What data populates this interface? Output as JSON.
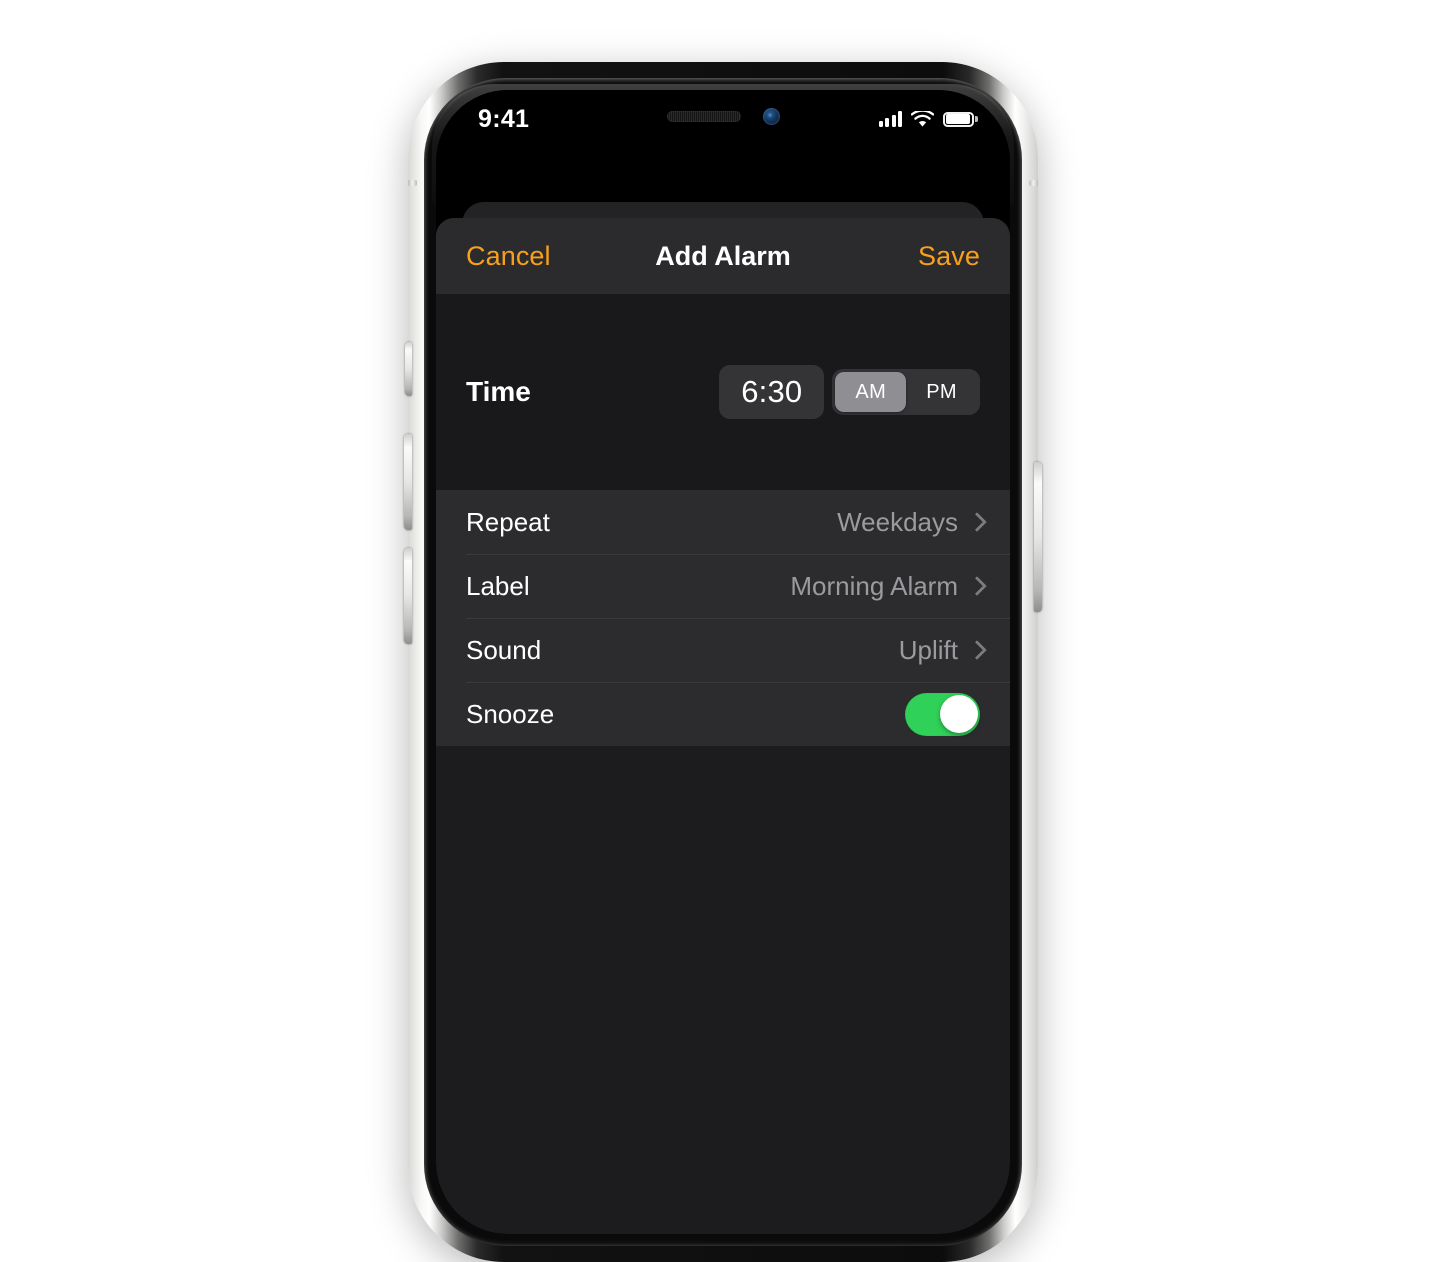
{
  "status_bar": {
    "time": "9:41",
    "signal_icon": "cellular-signal-icon",
    "wifi_icon": "wifi-icon",
    "battery_icon": "battery-icon"
  },
  "nav_bar": {
    "cancel_label": "Cancel",
    "title": "Add Alarm",
    "save_label": "Save",
    "accent_color": "#f7a01e"
  },
  "time_section": {
    "label": "Time",
    "value": "6:30",
    "ampm_options": [
      "AM",
      "PM"
    ],
    "am_label": "AM",
    "pm_label": "PM",
    "selected_period": "AM"
  },
  "rows": [
    {
      "label": "Repeat",
      "value": "Weekdays",
      "accessory": "chevron"
    },
    {
      "label": "Label",
      "value": "Morning Alarm",
      "accessory": "chevron"
    },
    {
      "label": "Sound",
      "value": "Uplift",
      "accessory": "chevron"
    },
    {
      "label": "Snooze",
      "value": "",
      "accessory": "toggle",
      "toggle_on": true
    }
  ],
  "colors": {
    "sheet_background": "#1c1c1e",
    "nav_background": "#2b2b2d",
    "time_section_background": "#19191b",
    "list_background": "#2c2c2e",
    "toggle_on": "#30d158",
    "segment_selected": "#8e8e93",
    "value_text": "#9b9b9f"
  }
}
